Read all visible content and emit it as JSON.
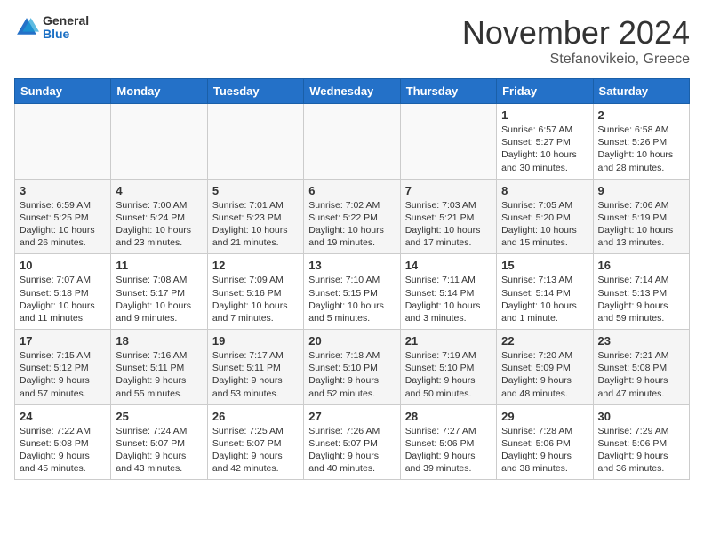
{
  "header": {
    "logo_general": "General",
    "logo_blue": "Blue",
    "month_title": "November 2024",
    "subtitle": "Stefanovikeio, Greece"
  },
  "days_of_week": [
    "Sunday",
    "Monday",
    "Tuesday",
    "Wednesday",
    "Thursday",
    "Friday",
    "Saturday"
  ],
  "weeks": [
    [
      {
        "day": "",
        "info": ""
      },
      {
        "day": "",
        "info": ""
      },
      {
        "day": "",
        "info": ""
      },
      {
        "day": "",
        "info": ""
      },
      {
        "day": "",
        "info": ""
      },
      {
        "day": "1",
        "info": "Sunrise: 6:57 AM\nSunset: 5:27 PM\nDaylight: 10 hours and 30 minutes."
      },
      {
        "day": "2",
        "info": "Sunrise: 6:58 AM\nSunset: 5:26 PM\nDaylight: 10 hours and 28 minutes."
      }
    ],
    [
      {
        "day": "3",
        "info": "Sunrise: 6:59 AM\nSunset: 5:25 PM\nDaylight: 10 hours and 26 minutes."
      },
      {
        "day": "4",
        "info": "Sunrise: 7:00 AM\nSunset: 5:24 PM\nDaylight: 10 hours and 23 minutes."
      },
      {
        "day": "5",
        "info": "Sunrise: 7:01 AM\nSunset: 5:23 PM\nDaylight: 10 hours and 21 minutes."
      },
      {
        "day": "6",
        "info": "Sunrise: 7:02 AM\nSunset: 5:22 PM\nDaylight: 10 hours and 19 minutes."
      },
      {
        "day": "7",
        "info": "Sunrise: 7:03 AM\nSunset: 5:21 PM\nDaylight: 10 hours and 17 minutes."
      },
      {
        "day": "8",
        "info": "Sunrise: 7:05 AM\nSunset: 5:20 PM\nDaylight: 10 hours and 15 minutes."
      },
      {
        "day": "9",
        "info": "Sunrise: 7:06 AM\nSunset: 5:19 PM\nDaylight: 10 hours and 13 minutes."
      }
    ],
    [
      {
        "day": "10",
        "info": "Sunrise: 7:07 AM\nSunset: 5:18 PM\nDaylight: 10 hours and 11 minutes."
      },
      {
        "day": "11",
        "info": "Sunrise: 7:08 AM\nSunset: 5:17 PM\nDaylight: 10 hours and 9 minutes."
      },
      {
        "day": "12",
        "info": "Sunrise: 7:09 AM\nSunset: 5:16 PM\nDaylight: 10 hours and 7 minutes."
      },
      {
        "day": "13",
        "info": "Sunrise: 7:10 AM\nSunset: 5:15 PM\nDaylight: 10 hours and 5 minutes."
      },
      {
        "day": "14",
        "info": "Sunrise: 7:11 AM\nSunset: 5:14 PM\nDaylight: 10 hours and 3 minutes."
      },
      {
        "day": "15",
        "info": "Sunrise: 7:13 AM\nSunset: 5:14 PM\nDaylight: 10 hours and 1 minute."
      },
      {
        "day": "16",
        "info": "Sunrise: 7:14 AM\nSunset: 5:13 PM\nDaylight: 9 hours and 59 minutes."
      }
    ],
    [
      {
        "day": "17",
        "info": "Sunrise: 7:15 AM\nSunset: 5:12 PM\nDaylight: 9 hours and 57 minutes."
      },
      {
        "day": "18",
        "info": "Sunrise: 7:16 AM\nSunset: 5:11 PM\nDaylight: 9 hours and 55 minutes."
      },
      {
        "day": "19",
        "info": "Sunrise: 7:17 AM\nSunset: 5:11 PM\nDaylight: 9 hours and 53 minutes."
      },
      {
        "day": "20",
        "info": "Sunrise: 7:18 AM\nSunset: 5:10 PM\nDaylight: 9 hours and 52 minutes."
      },
      {
        "day": "21",
        "info": "Sunrise: 7:19 AM\nSunset: 5:10 PM\nDaylight: 9 hours and 50 minutes."
      },
      {
        "day": "22",
        "info": "Sunrise: 7:20 AM\nSunset: 5:09 PM\nDaylight: 9 hours and 48 minutes."
      },
      {
        "day": "23",
        "info": "Sunrise: 7:21 AM\nSunset: 5:08 PM\nDaylight: 9 hours and 47 minutes."
      }
    ],
    [
      {
        "day": "24",
        "info": "Sunrise: 7:22 AM\nSunset: 5:08 PM\nDaylight: 9 hours and 45 minutes."
      },
      {
        "day": "25",
        "info": "Sunrise: 7:24 AM\nSunset: 5:07 PM\nDaylight: 9 hours and 43 minutes."
      },
      {
        "day": "26",
        "info": "Sunrise: 7:25 AM\nSunset: 5:07 PM\nDaylight: 9 hours and 42 minutes."
      },
      {
        "day": "27",
        "info": "Sunrise: 7:26 AM\nSunset: 5:07 PM\nDaylight: 9 hours and 40 minutes."
      },
      {
        "day": "28",
        "info": "Sunrise: 7:27 AM\nSunset: 5:06 PM\nDaylight: 9 hours and 39 minutes."
      },
      {
        "day": "29",
        "info": "Sunrise: 7:28 AM\nSunset: 5:06 PM\nDaylight: 9 hours and 38 minutes."
      },
      {
        "day": "30",
        "info": "Sunrise: 7:29 AM\nSunset: 5:06 PM\nDaylight: 9 hours and 36 minutes."
      }
    ]
  ]
}
